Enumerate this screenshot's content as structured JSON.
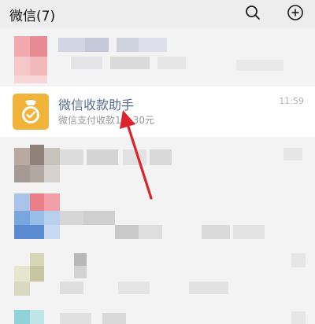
{
  "header": {
    "title": "微信(7)",
    "search_icon": "search-icon",
    "add_icon": "plus-circle-icon"
  },
  "chats": [
    {
      "obscured": true
    },
    {
      "name": "微信收款助手",
      "time": "11:59",
      "preview": "微信支付收款1■.30元",
      "avatar_icon": "money-bag-check-icon",
      "avatar_color": "#f0b43a",
      "name_color": "#576b95"
    },
    {
      "obscured": true
    },
    {
      "obscured": true
    },
    {
      "obscured": true
    },
    {
      "obscured": true
    }
  ],
  "annotation": {
    "arrow_color": "#e0222a"
  }
}
